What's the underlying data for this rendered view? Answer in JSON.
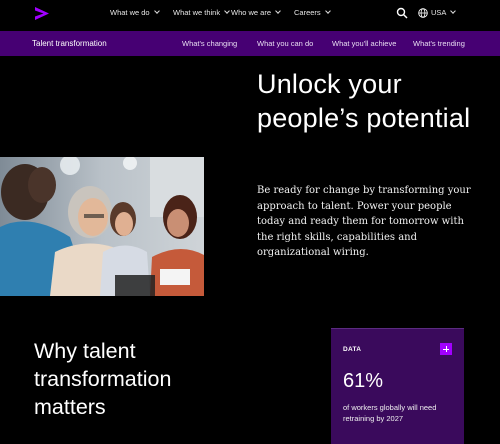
{
  "topnav": {
    "logo_icon": "accenture-greater-than-logo-icon",
    "brand_color": "#a100ff",
    "links": [
      "What we do",
      "What we think",
      "Who we are",
      "Careers"
    ],
    "search_icon": "search-icon",
    "globe_icon": "globe-icon",
    "locale": "USA"
  },
  "subnav": {
    "background": "#460073",
    "title": "Talent transformation",
    "links": [
      "What's changing",
      "What you can do",
      "What you'll achieve",
      "What's trending"
    ]
  },
  "hero": {
    "title": "Unlock your people’s potential",
    "body": "Be ready for change by transforming your approach to talent. Power your people today and ready them for tomorrow with the right skills, capabilities and organizational wiring."
  },
  "section": {
    "title": "Why talent transformation matters"
  },
  "card": {
    "label": "DATA",
    "value": "61%",
    "description": "of workers globally will need retraining by 2027",
    "expand_icon": "plus-icon",
    "background": "#3a0a5c"
  }
}
